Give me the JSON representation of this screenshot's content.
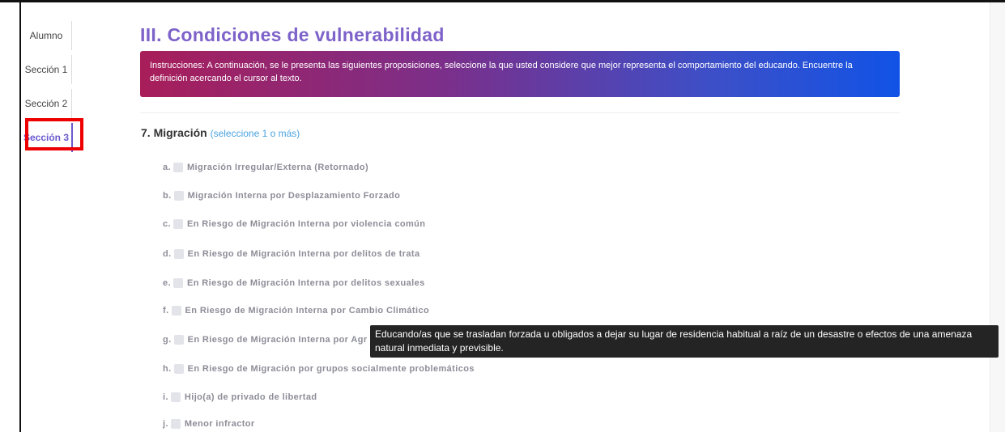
{
  "sidebar": {
    "items": [
      {
        "label": "Alumno"
      },
      {
        "label": "Sección 1"
      },
      {
        "label": "Sección 2"
      },
      {
        "label": "Sección 3"
      }
    ]
  },
  "section": {
    "title": "III. Condiciones de vulnerabilidad",
    "instructions": "Instrucciones: A continuación, se le presenta las siguientes proposiciones, seleccione la que usted considere que mejor representa el comportamiento del educando. Encuentre la definición acercando el cursor al texto."
  },
  "question": {
    "title": "7. Migración",
    "hint": "(seleccione 1 o más)",
    "options": [
      {
        "letter": "a.",
        "label": "Migración Irregular/Externa (Retornado)"
      },
      {
        "letter": "b.",
        "label": "Migración Interna por Desplazamiento Forzado"
      },
      {
        "letter": "c.",
        "label": "En Riesgo de Migración Interna por violencia común"
      },
      {
        "letter": "d.",
        "label": "En Riesgo de Migración Interna por delitos de trata"
      },
      {
        "letter": "e.",
        "label": "En Riesgo de Migración Interna por delitos sexuales"
      },
      {
        "letter": "f.",
        "label": "En Riesgo de Migración Interna por Cambio Climático"
      },
      {
        "letter": "g.",
        "label": "En Riesgo de Migración Interna por Agr"
      },
      {
        "letter": "h.",
        "label": "En Riesgo de Migración por grupos socialmente problemáticos"
      },
      {
        "letter": "i.",
        "label": "Hijo(a) de privado de libertad"
      },
      {
        "letter": "j.",
        "label": "Menor infractor"
      }
    ]
  },
  "tooltip": {
    "text": "Educando/as que se trasladan forzada u obligados a dejar su lugar de residencia habitual a raíz de un desastre o efectos de una amenaza natural inmediata y previsible."
  },
  "colors": {
    "title": "#7d62c9",
    "hint": "#4aa3df",
    "highlight": "#ee0000",
    "tooltip_bg": "#242424"
  }
}
